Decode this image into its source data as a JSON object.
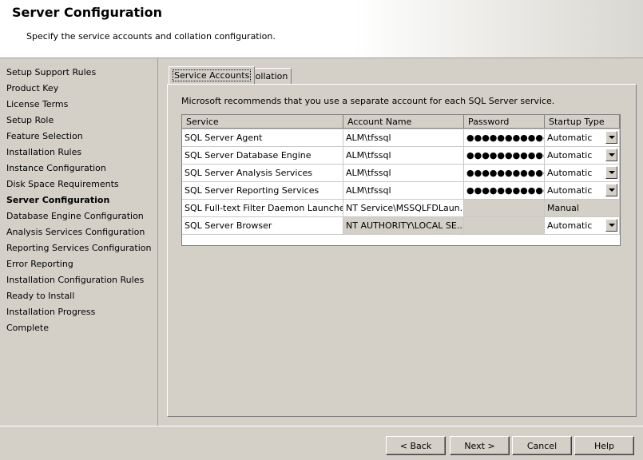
{
  "header": {
    "title": "Server Configuration",
    "subtitle": "Specify the service accounts and collation configuration."
  },
  "nav": {
    "items": [
      {
        "label": "Setup Support Rules"
      },
      {
        "label": "Product Key"
      },
      {
        "label": "License Terms"
      },
      {
        "label": "Setup Role"
      },
      {
        "label": "Feature Selection"
      },
      {
        "label": "Installation Rules"
      },
      {
        "label": "Instance Configuration"
      },
      {
        "label": "Disk Space Requirements"
      },
      {
        "label": "Server Configuration",
        "active": true
      },
      {
        "label": "Database Engine Configuration"
      },
      {
        "label": "Analysis Services Configuration"
      },
      {
        "label": "Reporting Services Configuration"
      },
      {
        "label": "Error Reporting"
      },
      {
        "label": "Installation Configuration Rules"
      },
      {
        "label": "Ready to Install"
      },
      {
        "label": "Installation Progress"
      },
      {
        "label": "Complete"
      }
    ]
  },
  "tabs": [
    {
      "label": "Service Accounts",
      "active": true
    },
    {
      "label": "Collation",
      "active": false
    }
  ],
  "panel": {
    "intro": "Microsoft recommends that you use a separate account for each SQL Server service."
  },
  "grid": {
    "columns": [
      "Service",
      "Account Name",
      "Password",
      "Startup Type"
    ],
    "rows": [
      {
        "service": "SQL Server Agent",
        "account": "ALM\\tfssql",
        "password": "●●●●●●●●●●●●",
        "startup": "Automatic",
        "editable": true
      },
      {
        "service": "SQL Server Database Engine",
        "account": "ALM\\tfssql",
        "password": "●●●●●●●●●●●●",
        "startup": "Automatic",
        "editable": true
      },
      {
        "service": "SQL Server Analysis Services",
        "account": "ALM\\tfssql",
        "password": "●●●●●●●●●●●●",
        "startup": "Automatic",
        "editable": true
      },
      {
        "service": "SQL Server Reporting Services",
        "account": "ALM\\tfssql",
        "password": "●●●●●●●●●●●●",
        "startup": "Automatic",
        "editable": true
      },
      {
        "service": "SQL Full-text Filter Daemon Launcher",
        "account": "NT Service\\MSSQLFDLaun...",
        "password": "",
        "startup": "Manual",
        "editable": false
      },
      {
        "service": "SQL Server Browser",
        "account": "NT AUTHORITY\\LOCAL SE...",
        "password": "",
        "startup": "Automatic",
        "editable": "partial"
      }
    ]
  },
  "buttons": {
    "back": "< Back",
    "next": "Next >",
    "cancel": "Cancel",
    "help": "Help"
  }
}
